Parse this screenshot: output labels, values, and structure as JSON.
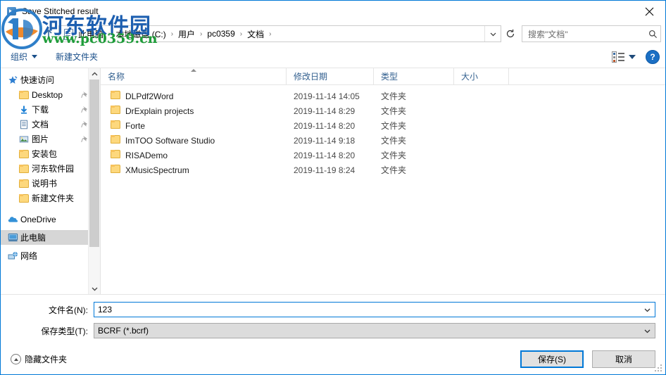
{
  "window": {
    "title": "Save Stitched result",
    "icon": "save-dialog-icon",
    "close_label": "✕"
  },
  "nav": {
    "back_icon": "back-arrow-icon",
    "forward_icon": "forward-arrow-icon",
    "up_icon": "up-arrow-icon",
    "refresh_icon": "refresh-icon",
    "dropdown_icon": "chevron-down-icon"
  },
  "address": {
    "icon": "document-folder-icon",
    "separator": "›",
    "crumbs": [
      {
        "label": "此电脑"
      },
      {
        "label": "本地磁盘 (C:)"
      },
      {
        "label": "用户"
      },
      {
        "label": "pc0359"
      },
      {
        "label": "文档"
      }
    ]
  },
  "search": {
    "placeholder": "搜索\"文档\"",
    "icon": "search-icon"
  },
  "toolbar": {
    "organize_label": "组织",
    "new_folder_label": "新建文件夹",
    "view_icon": "details-view-icon",
    "help_label": "?",
    "help_icon": "help-icon"
  },
  "sidebar": {
    "items": [
      {
        "label": "快速访问",
        "icon": "star-icon",
        "indent": false,
        "pinned": false,
        "selected": false
      },
      {
        "label": "Desktop",
        "icon": "folder-icon",
        "indent": true,
        "pinned": true,
        "selected": false
      },
      {
        "label": "下载",
        "icon": "download-icon",
        "indent": true,
        "pinned": true,
        "selected": false
      },
      {
        "label": "文档",
        "icon": "document-icon",
        "indent": true,
        "pinned": true,
        "selected": false
      },
      {
        "label": "图片",
        "icon": "pictures-icon",
        "indent": true,
        "pinned": true,
        "selected": false
      },
      {
        "label": "安装包",
        "icon": "folder-icon",
        "indent": true,
        "pinned": false,
        "selected": false
      },
      {
        "label": "河东软件园",
        "icon": "folder-icon",
        "indent": true,
        "pinned": false,
        "selected": false
      },
      {
        "label": "说明书",
        "icon": "folder-icon",
        "indent": true,
        "pinned": false,
        "selected": false
      },
      {
        "label": "新建文件夹",
        "icon": "folder-icon",
        "indent": true,
        "pinned": false,
        "selected": false
      },
      {
        "label": "OneDrive",
        "icon": "onedrive-icon",
        "indent": false,
        "pinned": false,
        "selected": false
      },
      {
        "label": "此电脑",
        "icon": "this-pc-icon",
        "indent": false,
        "pinned": false,
        "selected": true
      },
      {
        "label": "网络",
        "icon": "network-icon",
        "indent": false,
        "pinned": false,
        "selected": false
      }
    ],
    "scrollbar": {
      "up_icon": "scroll-up-icon",
      "down_icon": "scroll-down-icon"
    }
  },
  "filelist": {
    "columns": [
      {
        "key": "name",
        "label": "名称",
        "sorted": "asc"
      },
      {
        "key": "date",
        "label": "修改日期",
        "sorted": ""
      },
      {
        "key": "type",
        "label": "类型",
        "sorted": ""
      },
      {
        "key": "size",
        "label": "大小",
        "sorted": ""
      }
    ],
    "rows": [
      {
        "name": "DLPdf2Word",
        "date": "2019-11-14 14:05",
        "type": "文件夹",
        "size": "",
        "icon": "folder-icon"
      },
      {
        "name": "DrExplain projects",
        "date": "2019-11-14 8:29",
        "type": "文件夹",
        "size": "",
        "icon": "folder-icon"
      },
      {
        "name": "Forte",
        "date": "2019-11-14 8:20",
        "type": "文件夹",
        "size": "",
        "icon": "folder-icon"
      },
      {
        "name": "ImTOO Software Studio",
        "date": "2019-11-14 9:18",
        "type": "文件夹",
        "size": "",
        "icon": "folder-icon"
      },
      {
        "name": "RISADemo",
        "date": "2019-11-14 8:20",
        "type": "文件夹",
        "size": "",
        "icon": "folder-icon"
      },
      {
        "name": "XMusicSpectrum",
        "date": "2019-11-19 8:24",
        "type": "文件夹",
        "size": "",
        "icon": "folder-icon"
      }
    ]
  },
  "form": {
    "filename_label": "文件名(N):",
    "filename_value": "123",
    "savetype_label": "保存类型(T):",
    "savetype_value": "BCRF (*.bcrf)",
    "dropdown_icon": "chevron-down-icon"
  },
  "footer": {
    "hide_folders_label": "隐藏文件夹",
    "hide_folders_icon": "collapse-up-icon",
    "save_label": "保存(S)",
    "cancel_label": "取消"
  },
  "watermark": {
    "site_name": "河东软件园",
    "url": "www.pc0359.cn",
    "logo_icon": "watermark-logo-icon"
  },
  "colors": {
    "accent": "#0078d7",
    "toolbar_link": "#1a4f8a",
    "column_header": "#33608f",
    "selection": "#d6d6d6",
    "watermark_blue": "#1d5fb0",
    "watermark_green": "#1f9d3a",
    "folder_yellow": "#fdd87d"
  }
}
